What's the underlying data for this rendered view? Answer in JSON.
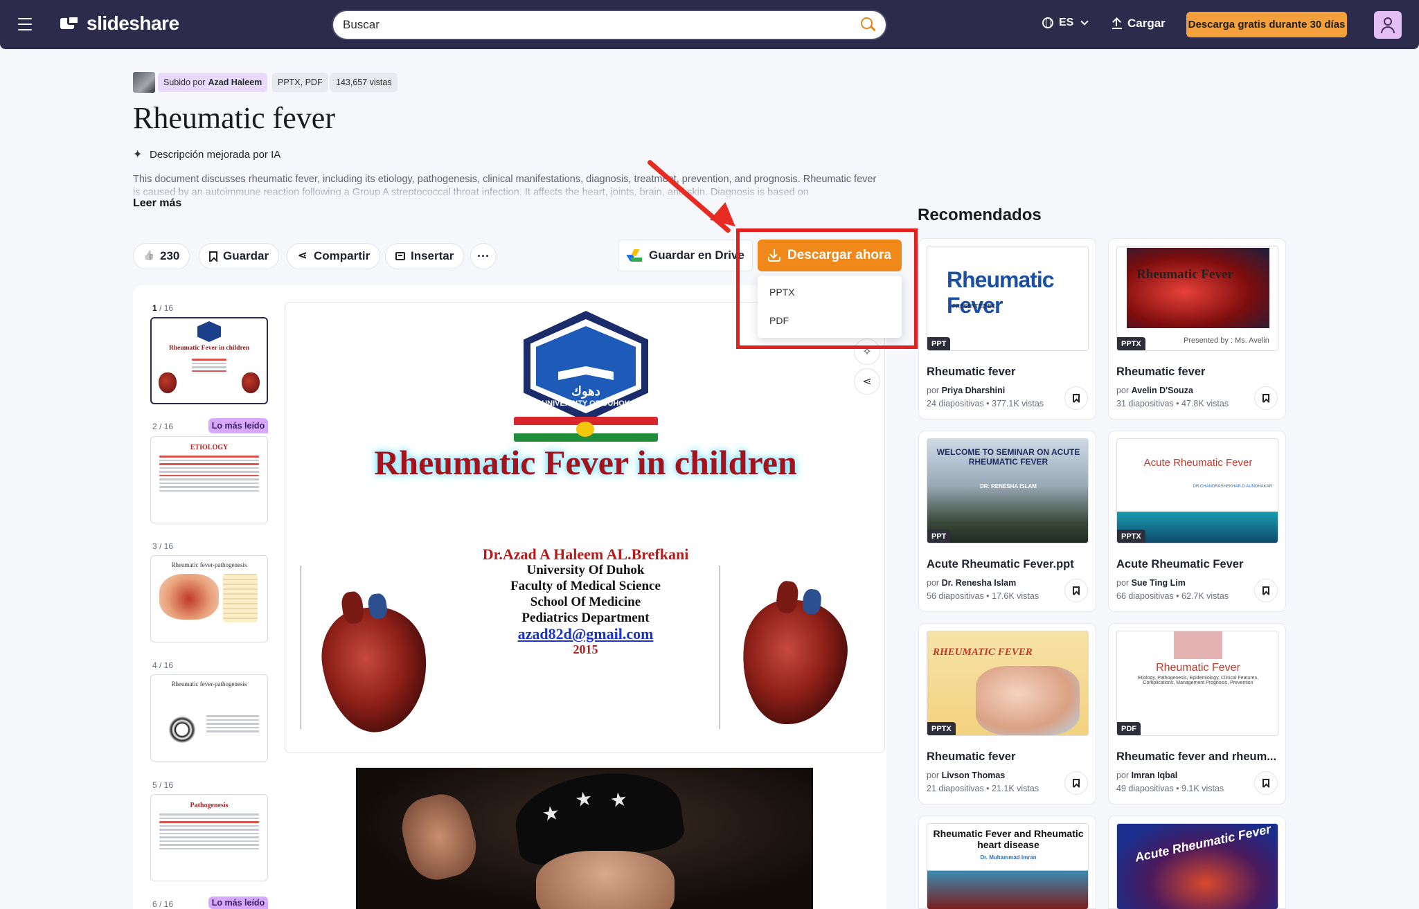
{
  "header": {
    "logo_text": "slideshare",
    "search_placeholder": "Buscar",
    "language": "ES",
    "upload_label": "Cargar",
    "trial_button": "Descarga gratis durante 30 días"
  },
  "document": {
    "uploaded_by_prefix": "Subido por",
    "uploader": "Azad Haleem",
    "formats": "PPTX, PDF",
    "views": "143,657 vistas",
    "title": "Rheumatic fever",
    "ai_note": "Descripción mejorada por IA",
    "description": "This document discusses rheumatic fever, including its etiology, pathogenesis, clinical manifestations, diagnosis, treatment, prevention, and prognosis. Rheumatic fever is caused by an autoimmune reaction following a Group A streptococcal throat infection. It affects the heart, joints, brain, and skin. Diagnosis is based on",
    "read_more": "Leer más"
  },
  "actions": {
    "likes": "230",
    "save": "Guardar",
    "share": "Compartir",
    "embed": "Insertar",
    "more": "···",
    "drive": "Guardar en Drive",
    "download": "Descargar ahora",
    "download_options": [
      "PPTX",
      "PDF"
    ]
  },
  "thumbnails": [
    {
      "label_current": "1",
      "label_total": " / 16",
      "title": "Rheumatic Fever in children"
    },
    {
      "label": "2 / 16",
      "badge": "Lo más leído",
      "title": "ETIOLOGY"
    },
    {
      "label": "3 / 16",
      "title": "Rheumatic fever-pathogenesis"
    },
    {
      "label": "4 / 16",
      "title": "Rheumatic fever-pathogenesis"
    },
    {
      "label": "5 / 16",
      "title": "Pathogenesis"
    },
    {
      "label": "6 / 16",
      "badge": "Lo más leído"
    }
  ],
  "slide": {
    "university_arabic": "دهوك",
    "university_name": "UNIVERSITY OF DUHOK",
    "title": "Rheumatic Fever in children",
    "author": "Dr.Azad A Haleem AL.Brefkani",
    "lines": [
      "University Of Duhok",
      "Faculty of Medical Science",
      "School Of Medicine",
      "Pediatrics  Department"
    ],
    "email": "azad82d@gmail.com",
    "year": "2015"
  },
  "recommended": {
    "title": "Recomendados",
    "by_prefix": "por",
    "cards": [
      {
        "title": "Rheumatic fever",
        "author": "Priya Dharshini",
        "stats": "24 diapositivas • 377.1K vistas",
        "format": "PPT",
        "thumb_text": "Rheumatic Fever",
        "thumb_sub": "PRESENTED BY,"
      },
      {
        "title": "Rheumatic fever",
        "author": "Avelin D'Souza",
        "stats": "31 diapositivas • 47.8K vistas",
        "format": "PPTX",
        "thumb_text": "Rheumatic Fever",
        "thumb_sub": "Presented by : Ms. Avelin"
      },
      {
        "title": "Acute Rheumatic Fever.ppt",
        "author": "Dr. Renesha Islam",
        "stats": "56 diapositivas • 17.6K vistas",
        "format": "PPT",
        "thumb_text": "WELCOME TO SEMINAR ON ACUTE RHEUMATIC FEVER",
        "thumb_sub": "DR. RENESHA ISLAM"
      },
      {
        "title": "Acute Rheumatic Fever",
        "author": "Sue Ting Lim",
        "stats": "66 diapositivas • 62.7K vistas",
        "format": "PPTX",
        "thumb_text": "Acute Rheumatic Fever",
        "thumb_sub": "DR.CHANDRASHEKHAR.D.AUNDHAKAR"
      },
      {
        "title": "Rheumatic fever",
        "author": "Livson Thomas",
        "stats": "21 diapositivas • 21.1K vistas",
        "format": "PPTX",
        "thumb_text": "RHEUMATIC FEVER"
      },
      {
        "title": "Rheumatic fever and rheum...",
        "author": "Imran Iqbal",
        "stats": "49 diapositivas • 9.1K vistas",
        "format": "PDF",
        "thumb_text": "Rheumatic Fever",
        "thumb_sub": "Etiology, Pathogenesis, Epidemiology, Clinical Features, Complications, Management Prognosis, Prevention"
      },
      {
        "thumb_text": "Rheumatic Fever and Rheumatic heart disease",
        "thumb_sub": "Dr. Muhammad Imran"
      },
      {
        "thumb_text": "Acute Rheumatic Fever"
      }
    ]
  },
  "colors": {
    "header_bg": "#2c2b4c",
    "accent_orange": "#f0891a",
    "annotation_red": "#e32020",
    "badge_purple": "#d6a8ff"
  }
}
